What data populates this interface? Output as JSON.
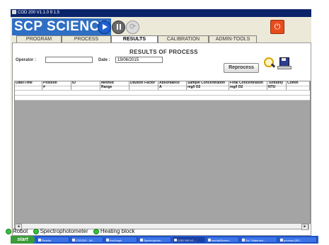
{
  "window": {
    "title": "COD 200 V1.1.0 9 1.5"
  },
  "brand": {
    "logo_text": "SCP SCIENCE"
  },
  "tabs": [
    {
      "label": "PROGRAM"
    },
    {
      "label": "PROCESS"
    },
    {
      "label": "RESULTS",
      "active": true
    },
    {
      "label": "CALIBRATION"
    },
    {
      "label": "ADMIN-TOOLS"
    }
  ],
  "results": {
    "title": "RESULTS OF PROCESS",
    "operator_label": "Operator :",
    "operator_value": "",
    "date_label": "Date :",
    "date_value": "19/06/2015",
    "reprocess_label": "Reprocess"
  },
  "table": {
    "columns": [
      {
        "header": "Date/Time",
        "sub": ""
      },
      {
        "header": "Position",
        "sub": "#"
      },
      {
        "header": "ID",
        "sub": ""
      },
      {
        "header": "Method",
        "sub": "Range"
      },
      {
        "header": "Dilution Factor",
        "sub": ""
      },
      {
        "header": "Absorbance",
        "sub": "A"
      },
      {
        "header": "Sample Concentration",
        "sub": "mg/l O2"
      },
      {
        "header": "Final Concentration",
        "sub": "mg/l O2"
      },
      {
        "header": "Turbidity",
        "sub": "NTU"
      },
      {
        "header": "Comm",
        "sub": ""
      }
    ],
    "scroll_left": "◄",
    "scroll_right": "►"
  },
  "status": {
    "robot": "Robot",
    "spectro": "Spectrophotometer",
    "heating": "Heating block",
    "indicator_color": "#36c23a"
  },
  "taskbar": {
    "start": "start",
    "items": [
      "Results",
      "COD200 - Mi...",
      "fvwGraph",
      "Spectrophoto...",
      "COD 200 V1....",
      "resultsRevers...",
      "Sol. Statemen...",
      "process (RG..."
    ]
  }
}
